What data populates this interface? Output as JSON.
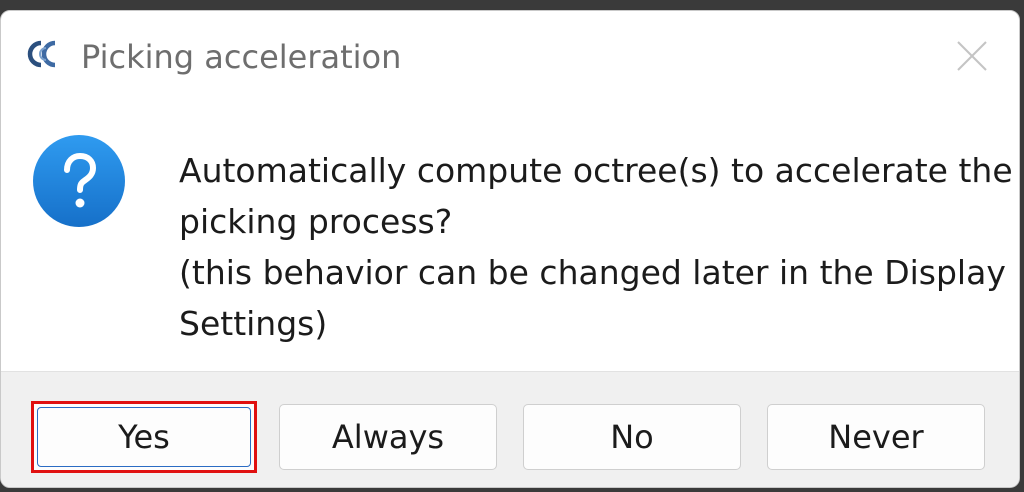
{
  "dialog": {
    "title": "Picking acceleration",
    "app_icon": "cloudcompare-logo-icon",
    "close_icon": "close-icon",
    "message_icon": "question-icon",
    "message_lines": [
      "Automatically compute octree(s) to accelerate the",
      "picking process?",
      "(this behavior can be changed later in the Display",
      "Settings)"
    ],
    "buttons": {
      "yes": "Yes",
      "always": "Always",
      "no": "No",
      "never": "Never"
    }
  },
  "colors": {
    "accent": "#1e88e5",
    "highlight_border": "#e01010",
    "footer_bg": "#f0f0f0"
  }
}
